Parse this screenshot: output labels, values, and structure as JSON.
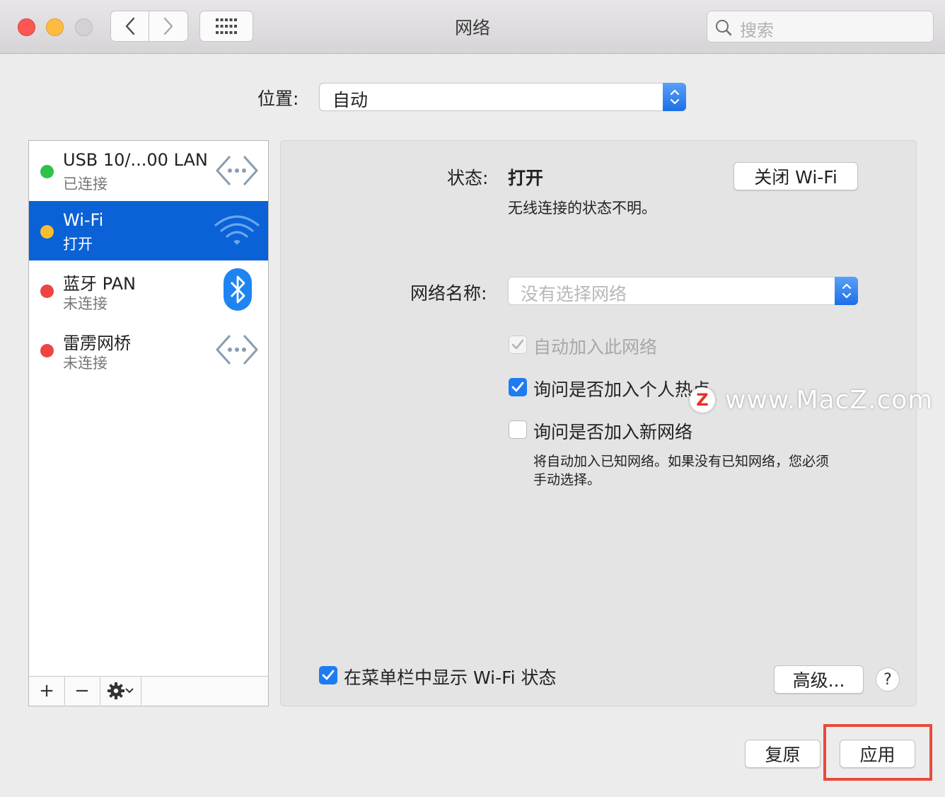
{
  "window": {
    "title": "网络",
    "search_placeholder": "搜索"
  },
  "location": {
    "label": "位置:",
    "value": "自动"
  },
  "services": [
    {
      "name": "USB 10/...00 LAN",
      "status": "已连接",
      "dot_color": "#2fc24a",
      "icon": "ethernet-icon"
    },
    {
      "name": "Wi-Fi",
      "status": "打开",
      "dot_color": "#f7bd2f",
      "icon": "wifi-icon",
      "selected": true
    },
    {
      "name": "蓝牙 PAN",
      "status": "未连接",
      "dot_color": "#ec4542",
      "icon": "bluetooth-icon"
    },
    {
      "name": "雷雳网桥",
      "status": "未连接",
      "dot_color": "#ec4542",
      "icon": "ethernet-icon"
    }
  ],
  "sidebar_controls": {
    "add": "+",
    "remove": "−"
  },
  "detail": {
    "status_label": "状态:",
    "status_value": "打开",
    "status_desc": "无线连接的状态不明。",
    "turn_off_button": "关闭 Wi-Fi",
    "network_name_label": "网络名称:",
    "network_name_placeholder": "没有选择网络",
    "auto_join": {
      "label": "自动加入此网络",
      "checked": true,
      "disabled": true
    },
    "ask_hotspot": {
      "label": "询问是否加入个人热点",
      "checked": true
    },
    "ask_new": {
      "label": "询问是否加入新网络",
      "checked": false
    },
    "ask_new_note_line1": "将自动加入已知网络。如果没有已知网络，您必须",
    "ask_new_note_line2": "手动选择。",
    "show_menubar": {
      "label": "在菜单栏中显示 Wi-Fi 状态",
      "checked": true
    },
    "advanced_button": "高级...",
    "help_button": "?"
  },
  "footer": {
    "revert_button": "复原",
    "apply_button": "应用"
  },
  "watermark": {
    "logo_letter": "Z",
    "text": "www.MacZ.com"
  },
  "colors": {
    "accent": "#1f7bf0",
    "selection": "#0a62d6",
    "highlight_box": "#ea4a3c"
  }
}
